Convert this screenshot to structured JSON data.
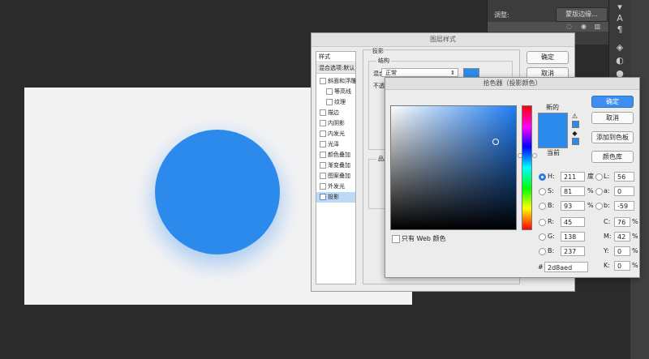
{
  "colors": {
    "accent": "#2d8aed",
    "workspace": "#2b2b2b",
    "canvas": "#f3f3f4",
    "button_primary": "#3d8ef0"
  },
  "panel": {
    "adjust_label": "调整:",
    "edit_button": "蒙版边缘..."
  },
  "layer_style": {
    "title": "图层样式",
    "list": {
      "header": "样式",
      "blend_default": "混合选项:默认",
      "items": [
        "斜面和浮雕",
        "等高线",
        "纹理",
        "描边",
        "内阴影",
        "内发光",
        "光泽",
        "颜色叠加",
        "渐变叠加",
        "图案叠加",
        "外发光",
        "投影"
      ]
    },
    "section_title": "投影",
    "group_title": "结构",
    "blend_mode_label": "混合模式:",
    "blend_mode_value": "正常",
    "opacity_label_partial": "不透",
    "quality_label_partial": "品质",
    "ok_button": "确定",
    "cancel_button": "取消"
  },
  "picker": {
    "title": "拾色器（投影颜色）",
    "new_label": "新的",
    "current_label": "当前",
    "ok_button": "确定",
    "cancel_button": "取消",
    "add_swatch_button": "添加到色板",
    "color_library_button": "颜色库",
    "web_only_label": "只有 Web 颜色",
    "hsb": {
      "h_label": "H:",
      "h_value": "211",
      "h_unit": "度",
      "s_label": "S:",
      "s_value": "81",
      "s_unit": "%",
      "b_label": "B:",
      "b_value": "93",
      "b_unit": "%"
    },
    "rgb": {
      "r_label": "R:",
      "r_value": "45",
      "g_label": "G:",
      "g_value": "138",
      "b_label": "B:",
      "b_value": "237"
    },
    "lab": {
      "l_label": "L:",
      "l_value": "56",
      "a_label": "a:",
      "a_value": "0",
      "b_label": "b:",
      "b_value": "-59"
    },
    "cmyk": {
      "c_label": "C:",
      "c_value": "76",
      "c_unit": "%",
      "m_label": "M:",
      "m_value": "42",
      "m_unit": "%",
      "y_label": "Y:",
      "y_value": "0",
      "y_unit": "%",
      "k_label": "K:",
      "k_value": "0",
      "k_unit": "%"
    },
    "hex_label": "#",
    "hex_value": "2d8aed"
  }
}
